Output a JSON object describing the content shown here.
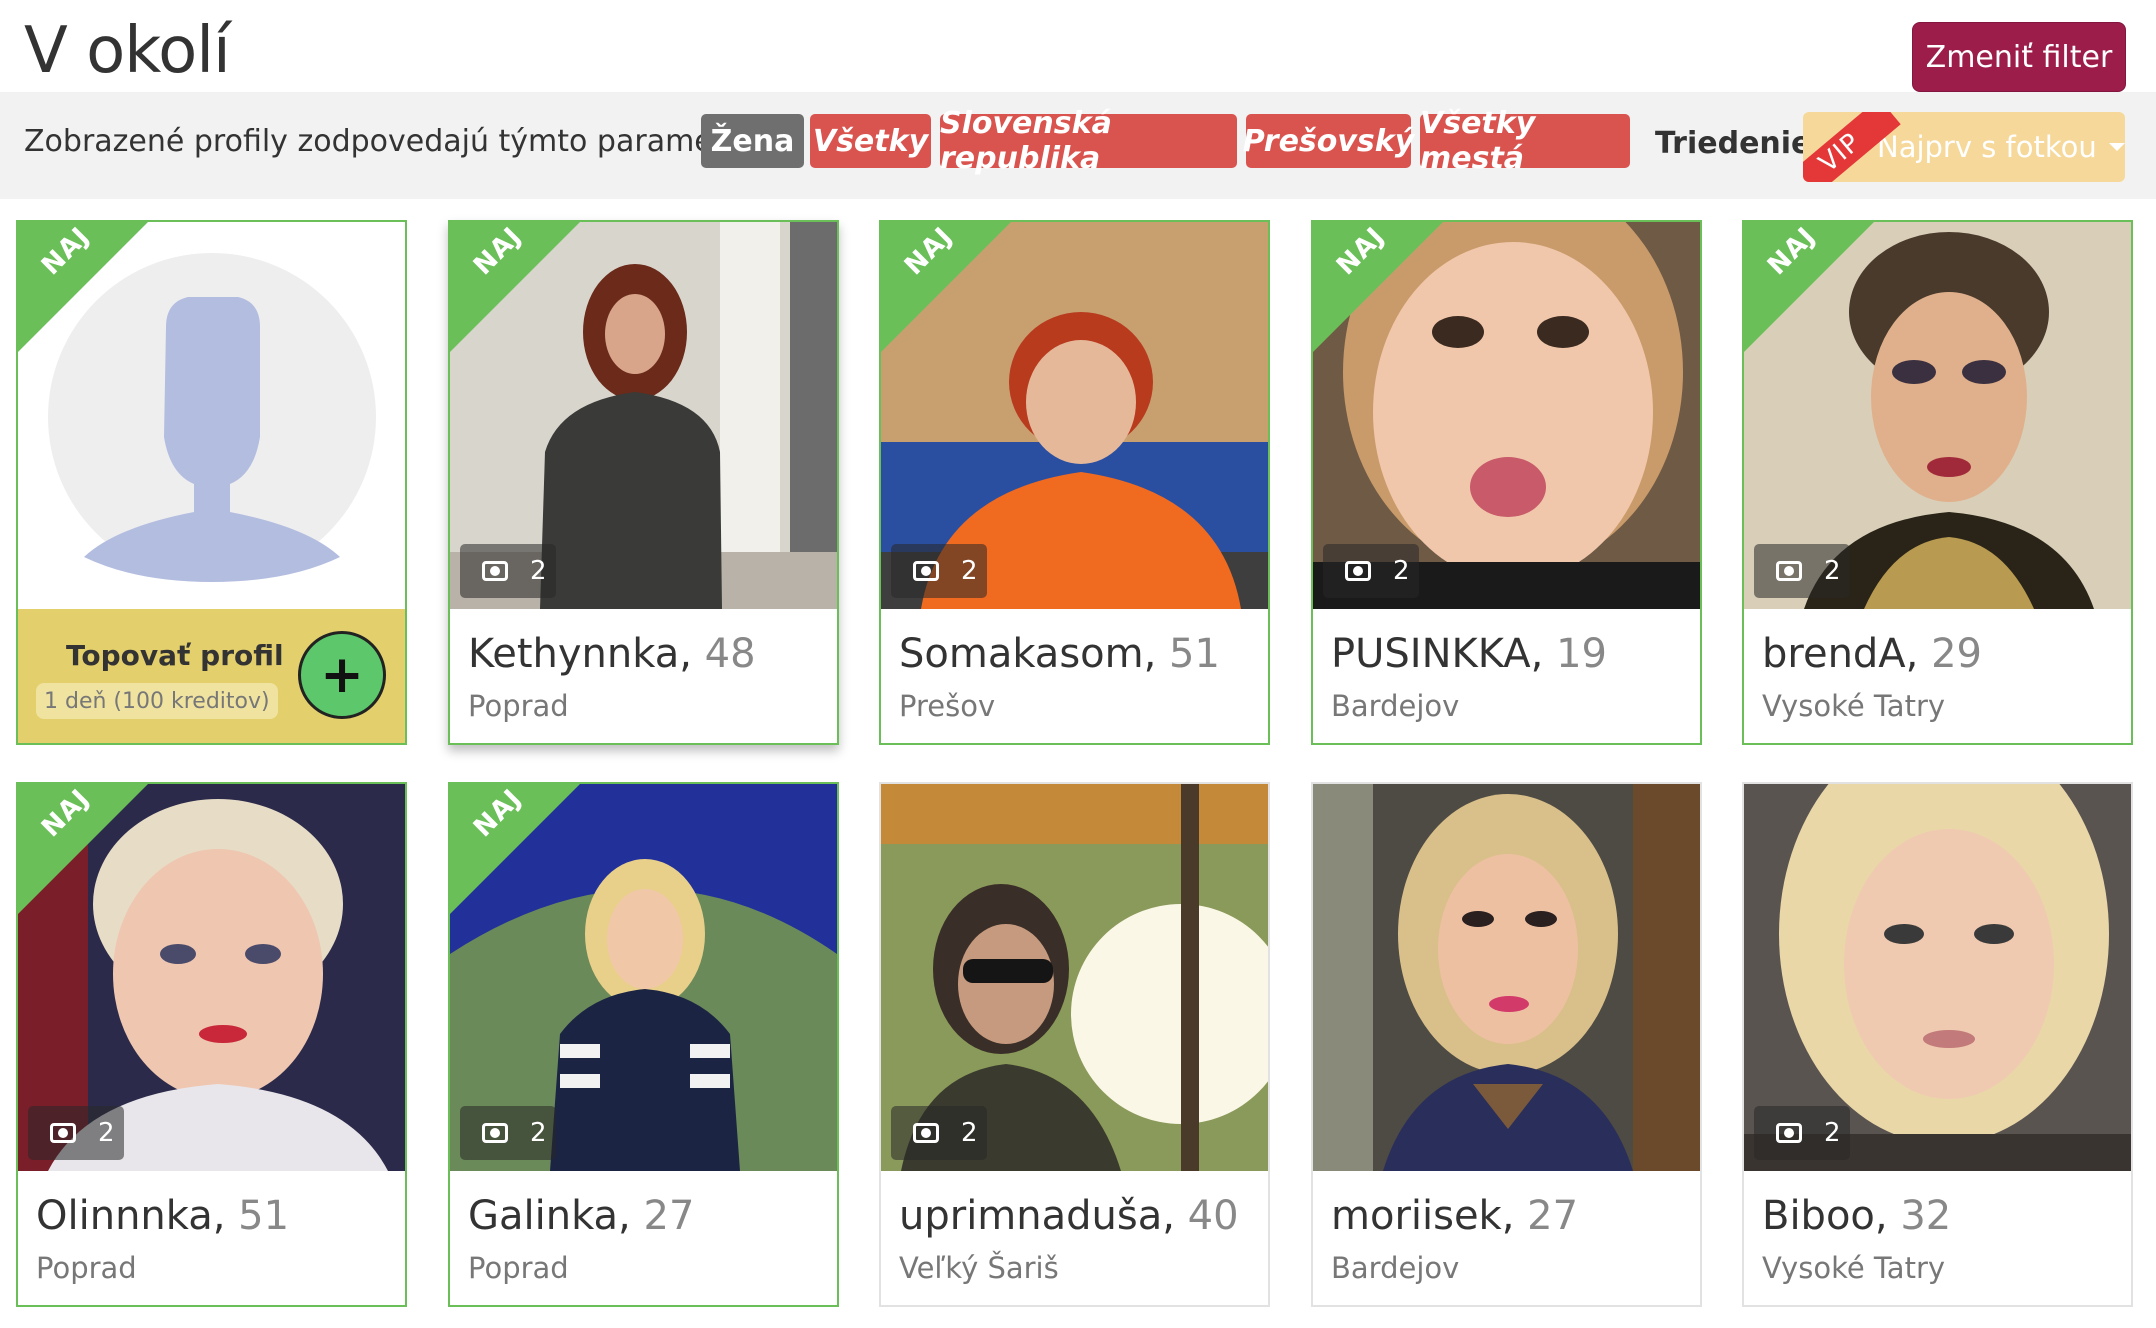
{
  "header": {
    "title": "V okolí",
    "filter_button": "Zmeniť filter"
  },
  "filterbar": {
    "label": "Zobrazené profily zodpovedajú týmto parametrom:",
    "chips": [
      "Žena",
      "Všetky",
      "Slovenská republika",
      "Prešovský",
      "Všetky mestá"
    ],
    "sort_label": "Triedenie:",
    "sort_value": "Najprv s fotkou",
    "vip_badge": "VIP"
  },
  "colors": {
    "accent": "#9c1d4a",
    "chip_red": "#d9534f",
    "chip_gray": "#6f6f6f",
    "top_green": "#6bbf59",
    "promo_yellow": "#e3cf6b"
  },
  "promo": {
    "badge": "NAJ",
    "title": "Topovať profil",
    "subtitle": "1 deň (100 kreditov)",
    "plus": "+"
  },
  "profiles": [
    {
      "name": "Kethynnka,",
      "age": "48",
      "city": "Poprad",
      "photos": "2",
      "badge": "NAJ"
    },
    {
      "name": "Somakasom,",
      "age": "51",
      "city": "Prešov",
      "photos": "2",
      "badge": "NAJ"
    },
    {
      "name": "PUSINKKA,",
      "age": "19",
      "city": "Bardejov",
      "photos": "2",
      "badge": "NAJ"
    },
    {
      "name": "brendA,",
      "age": "29",
      "city": "Vysoké Tatry",
      "photos": "2",
      "badge": "NAJ"
    },
    {
      "name": "Olinnnka,",
      "age": "51",
      "city": "Poprad",
      "photos": "2",
      "badge": "NAJ"
    },
    {
      "name": "Galinka,",
      "age": "27",
      "city": "Poprad",
      "photos": "2",
      "badge": "NAJ"
    },
    {
      "name": "uprimnaduša,",
      "age": "40",
      "city": "Veľký Šariš",
      "photos": "2"
    },
    {
      "name": "moriisek,",
      "age": "27",
      "city": "Bardejov"
    },
    {
      "name": "Biboo,",
      "age": "32",
      "city": "Vysoké Tatry",
      "photos": "2"
    }
  ]
}
